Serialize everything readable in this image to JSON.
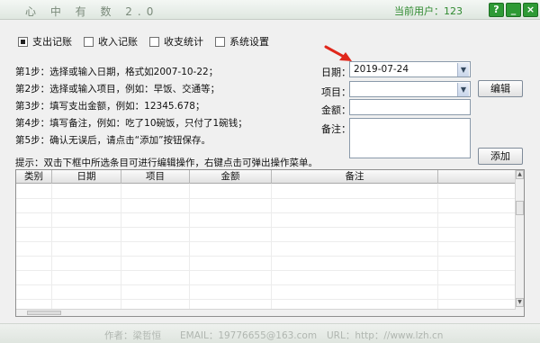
{
  "window": {
    "title": "心 中 有 数  2.0",
    "current_user_label": "当前用户：123",
    "buttons": [
      "?",
      "_",
      "×"
    ]
  },
  "tabs": [
    {
      "label": "支出记账",
      "checked": true
    },
    {
      "label": "收入记账",
      "checked": false
    },
    {
      "label": "收支统计",
      "checked": false
    },
    {
      "label": "系统设置",
      "checked": false
    }
  ],
  "steps": [
    "第1步：选择或输入日期，格式如2007-10-22；",
    "第2步：选择或输入项目，例如：早饭、交通等；",
    "第3步：填写支出金额，例如：12345.678；",
    "第4步：填写备注，例如：吃了10碗饭，只付了1碗钱；",
    "第5步：确认无误后，请点击“添加”按钮保存。"
  ],
  "form": {
    "date_label": "日期：",
    "date_value": "2019-07-24",
    "item_label": "项目：",
    "item_value": "",
    "amount_label": "金额：",
    "amount_value": "",
    "note_label": "备注：",
    "note_value": "",
    "edit_button": "编辑",
    "add_button": "添加"
  },
  "hint": "提示：双击下框中所选条目可进行编辑操作，右键点击可弹出操作菜单。",
  "table": {
    "columns": [
      "类别",
      "日期",
      "项目",
      "金额",
      "备注"
    ],
    "rows": []
  },
  "footer": {
    "author": "作者：梁哲恒",
    "email": "EMAIL：19776655@163.com",
    "url": "URL：http：//www.lzh.cn"
  },
  "colors": {
    "accent_green": "#2e9a35",
    "arrow_red": "#e0271b",
    "user_label": "#2f8a2f"
  }
}
